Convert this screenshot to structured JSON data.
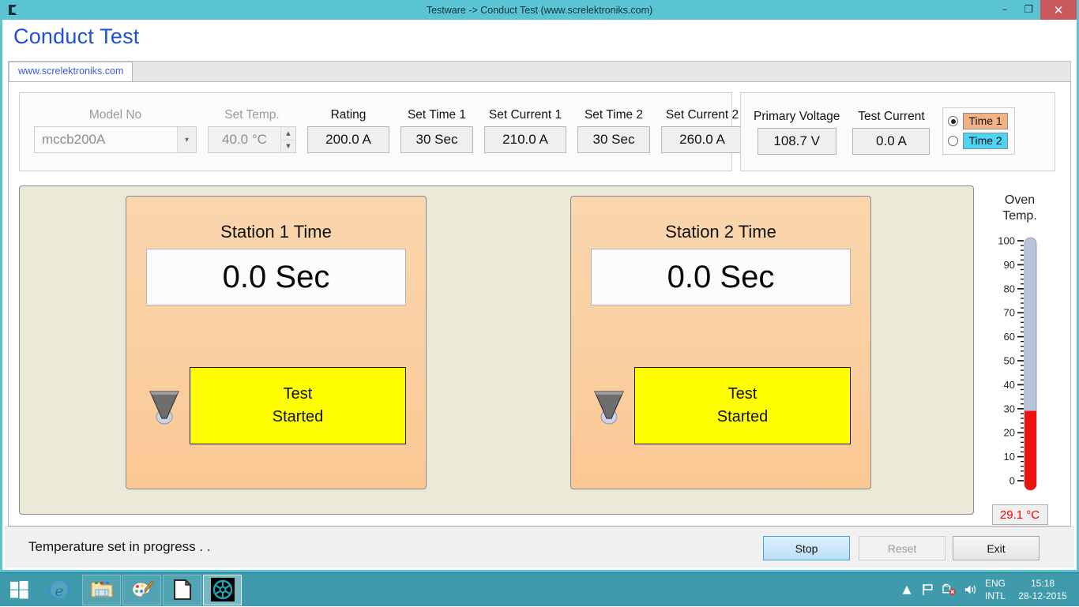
{
  "window": {
    "title": "Testware -> Conduct Test (www.screlektroniks.com)",
    "app_icon": "app-logo-icon",
    "minimize": "–",
    "restore": "❐",
    "close": "✕"
  },
  "header": {
    "page_title": "Conduct Test"
  },
  "tabs": [
    {
      "label": "www.screlektroniks.com",
      "active": true
    }
  ],
  "parameters": [
    {
      "name": "model-no",
      "label": "Model No",
      "value": "mccb200A",
      "type": "combo",
      "disabled": true
    },
    {
      "name": "set-temp",
      "label": "Set Temp.",
      "value": "40.0 °C",
      "type": "spinner",
      "disabled": true
    },
    {
      "name": "rating",
      "label": "Rating",
      "value": "200.0 A",
      "type": "readout",
      "disabled": false
    },
    {
      "name": "set-time-1",
      "label": "Set Time 1",
      "value": "30 Sec",
      "type": "readout",
      "disabled": false
    },
    {
      "name": "set-current-1",
      "label": "Set Current 1",
      "value": "210.0 A",
      "type": "readout",
      "disabled": false
    },
    {
      "name": "set-time-2",
      "label": "Set Time 2",
      "value": "30 Sec",
      "type": "readout",
      "disabled": false
    },
    {
      "name": "set-current-2",
      "label": "Set Current 2",
      "value": "260.0 A",
      "type": "readout",
      "disabled": false
    }
  ],
  "readouts": [
    {
      "name": "primary-voltage",
      "label": "Primary Voltage",
      "value": "108.7 V"
    },
    {
      "name": "test-current",
      "label": "Test Current",
      "value": "0.0 A"
    }
  ],
  "time_selector": {
    "options": [
      {
        "label": "Time 1",
        "selected": true,
        "color": "#f4b183"
      },
      {
        "label": "Time 2",
        "selected": false,
        "color": "#4fd4f4"
      }
    ]
  },
  "stations": [
    {
      "name": "station-1",
      "title": "Station 1 Time",
      "time_value": "0.0 Sec",
      "status_line_1": "Test",
      "status_line_2": "Started",
      "status_color": "#ffff00",
      "icon": "funnel-icon"
    },
    {
      "name": "station-2",
      "title": "Station 2 Time",
      "time_value": "0.0 Sec",
      "status_line_1": "Test",
      "status_line_2": "Started",
      "status_color": "#ffff00",
      "icon": "funnel-icon"
    }
  ],
  "chart_data": {
    "type": "bar",
    "title_line_1": "Oven",
    "title_line_2": "Temp.",
    "ylabel": "°C",
    "ylim": [
      0,
      100
    ],
    "tick_labels": [
      "0",
      "10",
      "20",
      "30",
      "40",
      "50",
      "60",
      "70",
      "80",
      "90",
      "100"
    ],
    "minor_tick_step": 2,
    "categories": [
      "Oven Temp."
    ],
    "values": [
      29.1
    ],
    "value_display": "29.1 °C",
    "fill_color": "#ee1111",
    "track_color": "#b9c4da",
    "value_text_color": "#ee0000",
    "grid": false,
    "legend": "none"
  },
  "statusbar": {
    "message": "Temperature set in progress . .",
    "buttons": [
      {
        "name": "stop",
        "label": "Stop",
        "state": "focused"
      },
      {
        "name": "reset",
        "label": "Reset",
        "state": "disabled"
      },
      {
        "name": "exit",
        "label": "Exit",
        "state": "normal"
      }
    ]
  },
  "taskbar": {
    "start": "windows-start-icon",
    "items": [
      {
        "name": "internet-explorer",
        "icon": "internet-explorer-icon",
        "active": false,
        "plain": true
      },
      {
        "name": "file-explorer",
        "icon": "folder-icon",
        "active": false,
        "plain": false
      },
      {
        "name": "paint",
        "icon": "paint-palette-icon",
        "active": false,
        "plain": false
      },
      {
        "name": "document",
        "icon": "document-icon",
        "active": false,
        "plain": false
      },
      {
        "name": "testware",
        "icon": "testware-logo-icon",
        "active": true,
        "plain": false
      }
    ],
    "tray": {
      "show_hidden": "▲",
      "flag": "flag-icon",
      "network": "network-error-icon",
      "volume": "speaker-icon",
      "lang_line_1": "ENG",
      "lang_line_2": "INTL",
      "time": "15:18",
      "date": "28-12-2015"
    }
  }
}
